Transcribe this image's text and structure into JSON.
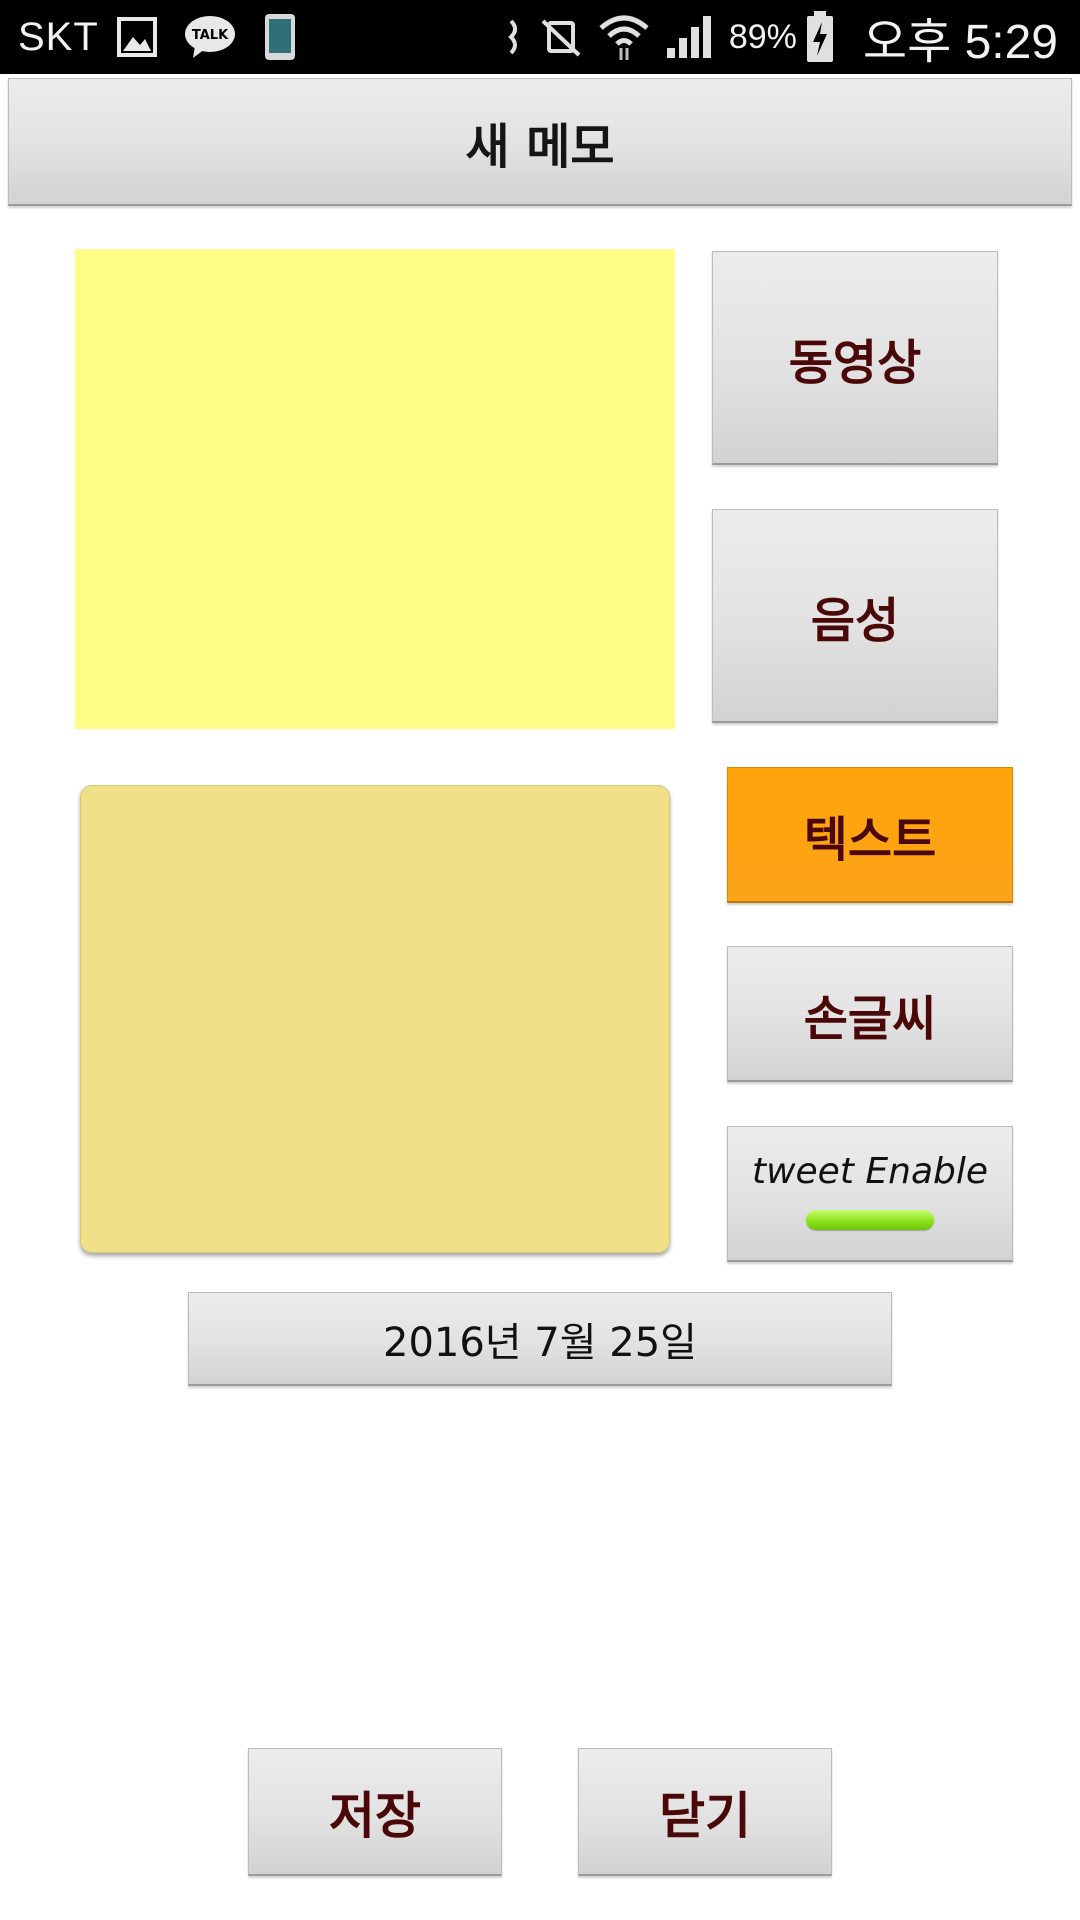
{
  "status_bar": {
    "carrier": "SKT",
    "battery_percent": "89%",
    "time": "오후 5:29",
    "icons": [
      "gallery-icon",
      "kakaotalk-icon",
      "phone-screen-icon",
      "nfc-icon",
      "mute-icon",
      "wifi-icon",
      "signal-icon",
      "battery-charging-icon"
    ],
    "kakao_text": "TALK"
  },
  "header": {
    "title": "새 메모"
  },
  "buttons": {
    "video": "동영상",
    "voice": "음성",
    "text": "텍스트",
    "handwriting": "손글씨",
    "tweet": "tweet Enable",
    "date": "2016년 7월 25일",
    "save": "저장",
    "close": "닫기"
  },
  "colors": {
    "photo_area": "#fffd88",
    "memo_area": "#f0e087",
    "text_button_active": "#ffa40a",
    "tweet_indicator": "#8ee21c",
    "button_label": "#4a0808"
  },
  "tweet_enabled": true
}
